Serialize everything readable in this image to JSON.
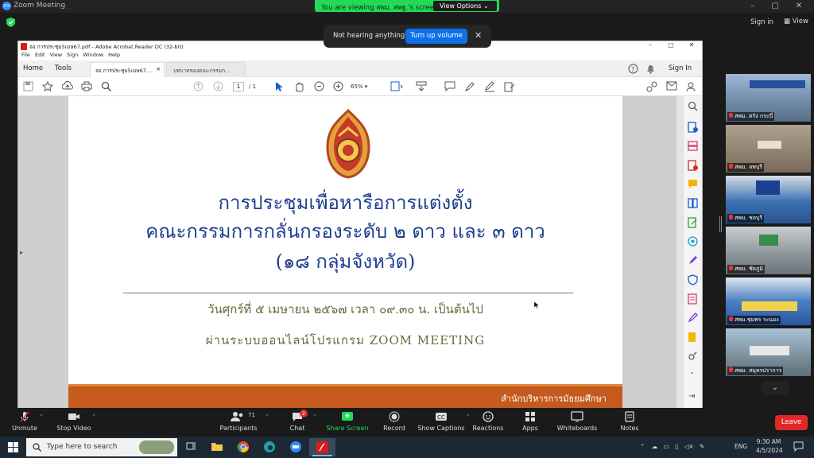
{
  "zoom": {
    "window_title": "Zoom Meeting",
    "viewing_text": "You are viewing สพม. สพฐ.'s screen",
    "view_options": "View Options",
    "sign_in": "Sign in",
    "view": "View",
    "notice_text": "Not hearing anything?",
    "notice_button": "Turn up volume"
  },
  "acrobat": {
    "title": "จอ การประชุม5เมษ67.pdf - Adobe Acrobat Reader DC (32-bit)",
    "menu": [
      "File",
      "Edit",
      "View",
      "Sign",
      "Window",
      "Help"
    ],
    "home": "Home",
    "tools": "Tools",
    "tab1": "จอ การประชุม5เมษ67....",
    "tab2": "บทบาทของคณะกรรมก...",
    "sign_in": "Sign In",
    "page_current": "1",
    "page_total": "/ 1",
    "zoom": "65%"
  },
  "document": {
    "heading_line1": "การประชุมเพื่อหารือการแต่งตั้ง",
    "heading_line2": "คณะกรรมการกลั่นกรองระดับ ๒ ดาว และ ๓ ดาว",
    "heading_line3": "(๑๘ กลุ่มจังหวัด)",
    "date_line": "วันศุกร์ที่ ๕ เมษายน ๒๕๖๗ เวลา ๐๙.๓๐ น. เป็นต้นไป",
    "via_line": "ผ่านระบบออนไลน์โปรแกรม ZOOM MEETING",
    "footer": "สำนักบริหารการมัธยมศึกษา"
  },
  "participants_videos": [
    {
      "label": "สพม. ตรัง กระบี่",
      "bg": "#7b8fa8"
    },
    {
      "label": "สพม. ลพบุรี",
      "bg": "#8a7a6a"
    },
    {
      "label": "สพม. ชลบุรี",
      "bg": "#3a6fb0"
    },
    {
      "label": "สพม. ชัยภูมิ",
      "bg": "#7d8a8c"
    },
    {
      "label": "สพม.ชุมพร ระนอง",
      "bg": "#4a7fc4"
    },
    {
      "label": "สพม. สมุทรปราการ",
      "bg": "#7c8f9c"
    }
  ],
  "controls": {
    "unmute": "Unmute",
    "stop_video": "Stop Video",
    "participants": "Participants",
    "participants_count": "71",
    "chat": "Chat",
    "chat_badge": "2",
    "share_screen": "Share Screen",
    "record": "Record",
    "show_captions": "Show Captions",
    "reactions": "Reactions",
    "apps": "Apps",
    "whiteboards": "Whiteboards",
    "notes": "Notes",
    "leave": "Leave"
  },
  "taskbar": {
    "search_placeholder": "Type here to search",
    "language": "ENG",
    "time": "9:30 AM",
    "date": "4/5/2024"
  },
  "colors": {
    "zoom_green": "#23d959",
    "zoom_blue": "#0e71eb",
    "leave_red": "#e02828",
    "doc_title_blue": "#1e3f8f",
    "footer_orange": "#c55a1f"
  }
}
